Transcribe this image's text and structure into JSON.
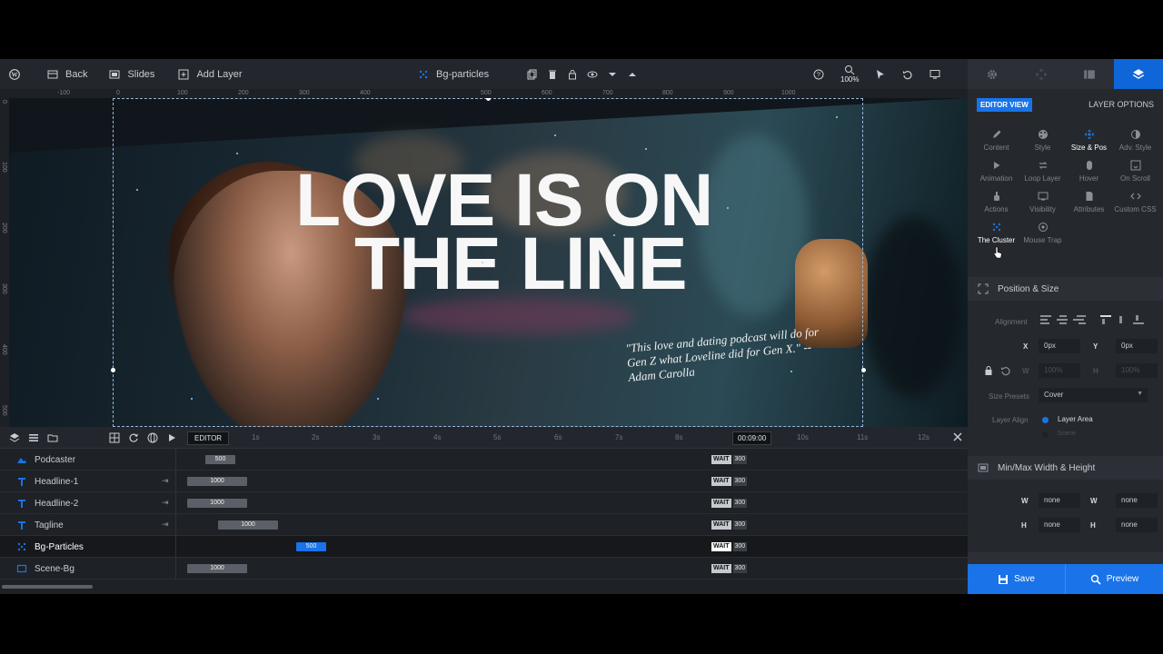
{
  "toolbar": {
    "back": "Back",
    "slides": "Slides",
    "add_layer": "Add Layer",
    "current_layer": "Bg-particles",
    "zoom": "100%"
  },
  "ruler": {
    "top": [
      "-100",
      "0",
      "100",
      "200",
      "300",
      "400",
      "500",
      "600",
      "700",
      "800",
      "900",
      "1000"
    ],
    "left": [
      "0",
      "100",
      "200",
      "300",
      "400",
      "500"
    ]
  },
  "canvas": {
    "headline_line1": "LOVE IS ON",
    "headline_line2": "THE LINE",
    "quote": "\"This love and dating podcast will do for Gen Z what Loveline did for Gen X.\" -- Adam Carolla"
  },
  "timeline": {
    "editor_label": "EDITOR",
    "seconds": [
      "1s",
      "2s",
      "3s",
      "4s",
      "5s",
      "6s",
      "7s",
      "8s",
      "9s",
      "10s",
      "11s",
      "12s"
    ],
    "current_time": "00:09:00",
    "layers": [
      {
        "name": "Podcaster",
        "icon": "image-icon",
        "duration": "500",
        "wait": "WAIT",
        "end": "300",
        "active": false
      },
      {
        "name": "Headline-1",
        "icon": "text-icon",
        "duration": "1000",
        "wait": "WAIT",
        "end": "300",
        "active": false
      },
      {
        "name": "Headline-2",
        "icon": "text-icon",
        "duration": "1000",
        "wait": "WAIT",
        "end": "300",
        "active": false
      },
      {
        "name": "Tagline",
        "icon": "text-icon",
        "duration": "1000",
        "wait": "WAIT",
        "end": "300",
        "active": false
      },
      {
        "name": "Bg-Particles",
        "icon": "particles-icon",
        "duration": "500",
        "wait": "WAIT",
        "end": "300",
        "active": true
      },
      {
        "name": "Scene-Bg",
        "icon": "shape-icon",
        "duration": "1000",
        "wait": "WAIT",
        "end": "300",
        "active": false
      }
    ]
  },
  "panel": {
    "editor_view": "EDITOR VIEW",
    "layer_options": "LAYER OPTIONS",
    "options": [
      {
        "label": "Content",
        "icon": "pencil-icon"
      },
      {
        "label": "Style",
        "icon": "palette-icon"
      },
      {
        "label": "Size & Pos",
        "icon": "move-icon"
      },
      {
        "label": "Adv. Style",
        "icon": "contrast-icon"
      },
      {
        "label": "Animation",
        "icon": "play-icon"
      },
      {
        "label": "Loop Layer",
        "icon": "loop-icon"
      },
      {
        "label": "Hover",
        "icon": "mouse-icon"
      },
      {
        "label": "On Scroll",
        "icon": "scroll-icon"
      },
      {
        "label": "Actions",
        "icon": "hand-icon"
      },
      {
        "label": "Visibility",
        "icon": "monitor-icon"
      },
      {
        "label": "Attributes",
        "icon": "document-icon"
      },
      {
        "label": "Custom CSS",
        "icon": "code-icon"
      },
      {
        "label": "The Cluster",
        "icon": "cluster-icon"
      },
      {
        "label": "Mouse Trap",
        "icon": "target-icon"
      }
    ],
    "position_size": {
      "title": "Position & Size",
      "alignment_label": "Alignment",
      "x_axis": "X",
      "x_value": "0px",
      "y_axis": "Y",
      "y_value": "0px",
      "w_axis": "W",
      "w_value": "100%",
      "h_axis": "H",
      "h_value": "100%",
      "size_presets_label": "Size Presets",
      "size_presets_value": "Cover",
      "layer_align_label": "Layer Align",
      "layer_area": "Layer Area",
      "scene": "Scene"
    },
    "minmax": {
      "title": "Min/Max Width & Height",
      "min_w": "none",
      "max_w": "none",
      "min_h": "none",
      "max_h": "none",
      "w_axis": "W",
      "h_axis": "H"
    },
    "save": "Save",
    "preview": "Preview"
  },
  "colors": {
    "accent": "#1a73e8",
    "panel_bg": "#25292e",
    "toolbar_bg": "#23272d"
  }
}
